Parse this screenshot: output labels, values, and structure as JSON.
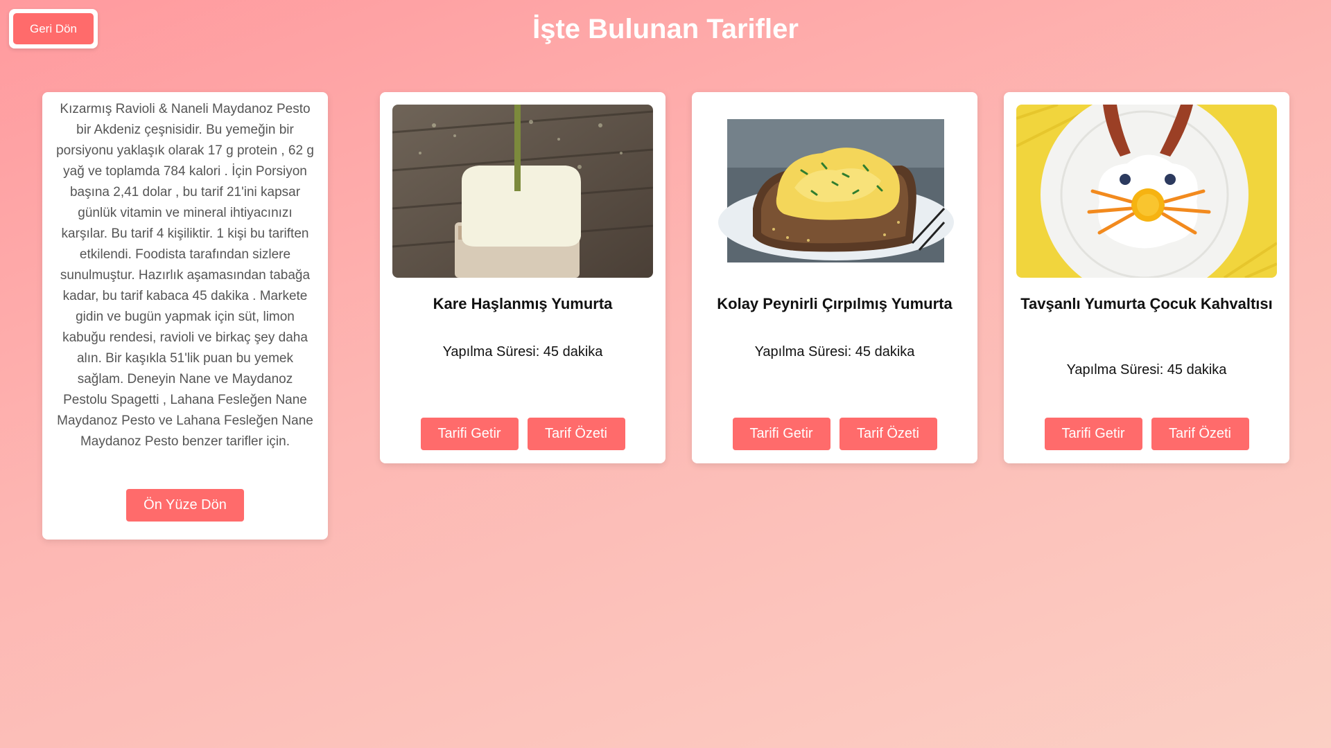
{
  "header": {
    "back_label": "Geri Dön",
    "title": "İşte Bulunan Tarifler"
  },
  "summary": {
    "text": "Kızarmış Ravioli & Naneli Maydanoz Pesto bir Akdeniz çeşnisidir. Bu yemeğin bir porsiyonu yaklaşık olarak 17 g protein , 62 g yağ ve toplamda 784 kalori . İçin Porsiyon başına 2,41 dolar , bu tarif 21'ini kapsar günlük vitamin ve mineral ihtiyacınızı karşılar. Bu tarif 4 kişiliktir. 1 kişi bu tariften etkilendi. Foodista tarafından sizlere sunulmuştur. Hazırlık aşamasından tabağa kadar, bu tarif kabaca 45 dakika . Markete gidin ve bugün yapmak için süt, limon kabuğu rendesi, ravioli ve birkaç şey daha alın. Bir kaşıkla 51'lik puan bu yemek sağlam. Deneyin Nane ve Maydanoz Pestolu Spagetti , Lahana Fesleğen Nane Maydanoz Pesto ve Lahana Fesleğen Nane Maydanoz Pesto benzer tarifler için.",
    "front_button": "Ön Yüze Dön"
  },
  "recipes": [
    {
      "title": "Kare Haşlanmış Yumurta",
      "time": "Yapılma Süresi: 45 dakika",
      "get_button": "Tarifi Getir",
      "summary_button": "Tarif Özeti",
      "image": "square-egg-on-skewer"
    },
    {
      "title": "Kolay Peynirli Çırpılmış Yumurta",
      "time": "Yapılma Süresi: 45 dakika",
      "get_button": "Tarifi Getir",
      "summary_button": "Tarif Özeti",
      "image": "scrambled-egg-toast"
    },
    {
      "title": "Tavşanlı Yumurta Çocuk Kahvaltısı",
      "time": "Yapılma Süresi: 45 dakika",
      "get_button": "Tarifi Getir",
      "summary_button": "Tarif Özeti",
      "image": "bunny-egg-plate"
    }
  ],
  "colors": {
    "accent": "#ff6b6b",
    "background_start": "#ff9a9e",
    "background_end": "#fbcfc4"
  }
}
